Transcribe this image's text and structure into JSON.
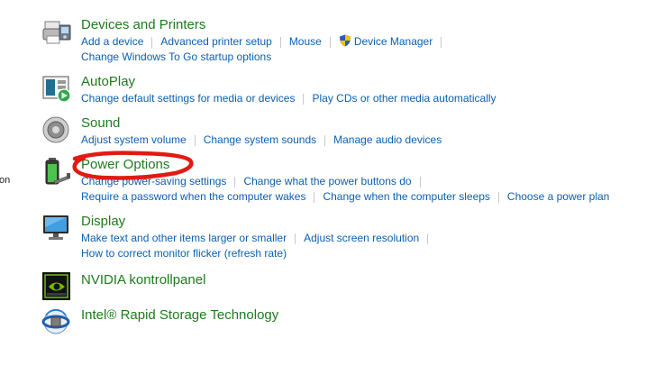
{
  "cut_label": "on",
  "colors": {
    "title_green": "#1e7b1e",
    "link_blue": "#0c5fb0",
    "annotation_red": "#e21a12"
  },
  "categories": [
    {
      "title": "Devices and Printers",
      "icon": "printer-icon",
      "rows": [
        [
          "Add a device",
          "Advanced printer setup",
          "Mouse",
          "Device Manager"
        ],
        [
          "Change Windows To Go startup options"
        ]
      ]
    },
    {
      "title": "AutoPlay",
      "icon": "autoplay-icon",
      "rows": [
        [
          "Change default settings for media or devices",
          "Play CDs or other media automatically"
        ]
      ]
    },
    {
      "title": "Sound",
      "icon": "speaker-icon",
      "rows": [
        [
          "Adjust system volume",
          "Change system sounds",
          "Manage audio devices"
        ]
      ]
    },
    {
      "title": "Power Options",
      "icon": "battery-icon",
      "rows": [
        [
          "Change power-saving settings",
          "Change what the power buttons do"
        ],
        [
          "Require a password when the computer wakes",
          "Change when the computer sleeps",
          "Choose a power plan"
        ]
      ]
    },
    {
      "title": "Display",
      "icon": "monitor-icon",
      "rows": [
        [
          "Make text and other items larger or smaller",
          "Adjust screen resolution"
        ],
        [
          "How to correct monitor flicker (refresh rate)"
        ]
      ]
    },
    {
      "title": "NVIDIA kontrollpanel",
      "icon": "nvidia-icon",
      "rows": []
    },
    {
      "title": "Intel® Rapid Storage Technology",
      "icon": "intel-rst-icon",
      "rows": []
    }
  ]
}
